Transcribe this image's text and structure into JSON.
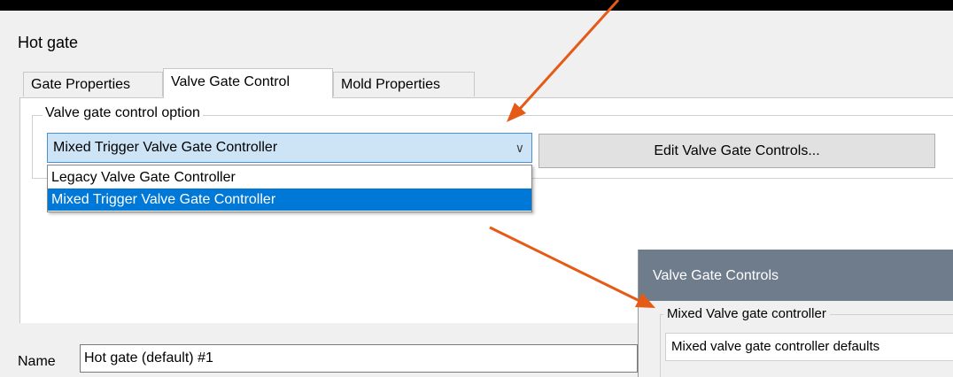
{
  "dialog": {
    "title": "Hot gate"
  },
  "tabs": [
    {
      "label": "Gate Properties",
      "active": false
    },
    {
      "label": "Valve Gate Control",
      "active": true
    },
    {
      "label": "Mold Properties",
      "active": false
    }
  ],
  "valve_gate": {
    "group_label": "Valve gate control option",
    "selected": "Mixed Trigger Valve Gate Controller",
    "options": [
      "Legacy Valve Gate Controller",
      "Mixed Trigger Valve Gate Controller"
    ],
    "edit_button": "Edit Valve Gate Controls..."
  },
  "name_field": {
    "label": "Name",
    "value": "Hot gate (default) #1"
  },
  "inset": {
    "title": "Valve Gate Controls",
    "group_label": "Mixed Valve gate controller",
    "value": "Mixed valve gate controller defaults"
  },
  "colors": {
    "annotation_arrow": "#e55a17",
    "selection": "#0078d7",
    "inset_header": "#6e7c8c"
  },
  "icons": {
    "combo_arrow": "chevron-down-icon"
  }
}
